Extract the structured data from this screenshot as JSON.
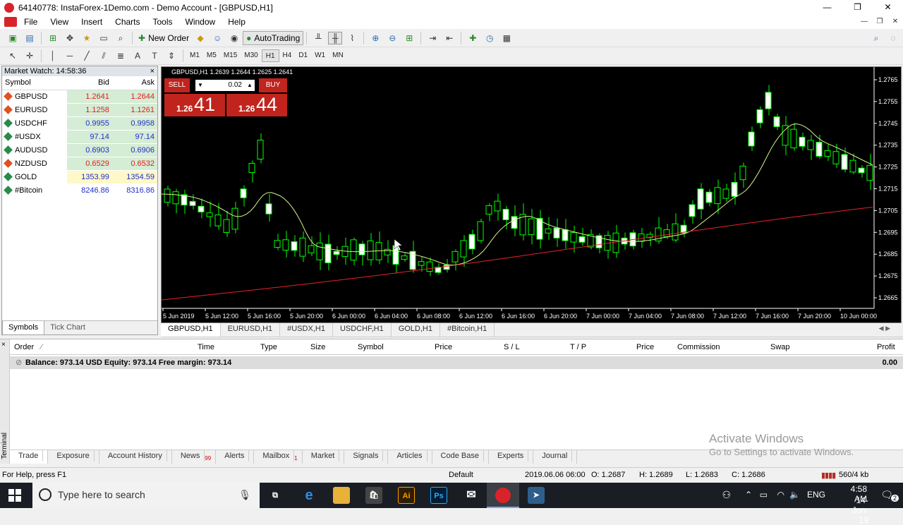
{
  "window": {
    "title": "64140778: InstaForex-1Demo.com - Demo Account - [GBPUSD,H1]",
    "controls": [
      "—",
      "❐",
      "✕"
    ]
  },
  "menu": [
    "File",
    "View",
    "Insert",
    "Charts",
    "Tools",
    "Window",
    "Help"
  ],
  "toolbar": {
    "new_order": "New Order",
    "autotrading": "AutoTrading"
  },
  "timeframes": [
    "M1",
    "M5",
    "M15",
    "M30",
    "H1",
    "H4",
    "D1",
    "W1",
    "MN"
  ],
  "selected_timeframe": "H1",
  "market_watch": {
    "title": "Market Watch: 14:58:36",
    "close": "×",
    "columns": {
      "symbol": "Symbol",
      "bid": "Bid",
      "ask": "Ask"
    },
    "rows": [
      {
        "symbol": "GBPUSD",
        "bid": "1.2641",
        "ask": "1.2644",
        "dir": "down"
      },
      {
        "symbol": "EURUSD",
        "bid": "1.1258",
        "ask": "1.1261",
        "dir": "down"
      },
      {
        "symbol": "USDCHF",
        "bid": "0.9955",
        "ask": "0.9958",
        "dir": "up"
      },
      {
        "symbol": "#USDX",
        "bid": "97.14",
        "ask": "97.14",
        "dir": "up"
      },
      {
        "symbol": "AUDUSD",
        "bid": "0.6903",
        "ask": "0.6906",
        "dir": "up"
      },
      {
        "symbol": "NZDUSD",
        "bid": "0.6529",
        "ask": "0.6532",
        "dir": "down"
      },
      {
        "symbol": "GOLD",
        "bid": "1353.99",
        "ask": "1354.59",
        "dir": "up"
      },
      {
        "symbol": "#Bitcoin",
        "bid": "8246.86",
        "ask": "8316.86",
        "dir": "up"
      }
    ],
    "tabs": [
      "Symbols",
      "Tick Chart"
    ]
  },
  "chart": {
    "header": "GBPUSD,H1  1.2639 1.2644 1.2625 1.2641",
    "one_click": {
      "sell": "SELL",
      "buy": "BUY",
      "lot": "0.02",
      "sell_big": "41",
      "sell_small": "1.26",
      "buy_big": "44",
      "buy_small": "1.26"
    },
    "price_labels": [
      "1.2765",
      "1.2755",
      "1.2745",
      "1.2735",
      "1.2725",
      "1.2715",
      "1.2705",
      "1.2695",
      "1.2685",
      "1.2675",
      "1.2665"
    ],
    "time_labels": [
      "5 Jun 2019",
      "5 Jun 12:00",
      "5 Jun 16:00",
      "5 Jun 20:00",
      "6 Jun 00:00",
      "6 Jun 04:00",
      "6 Jun 08:00",
      "6 Jun 12:00",
      "6 Jun 16:00",
      "6 Jun 20:00",
      "7 Jun 00:00",
      "7 Jun 04:00",
      "7 Jun 08:00",
      "7 Jun 12:00",
      "7 Jun 16:00",
      "7 Jun 20:00",
      "10 Jun 00:00"
    ],
    "colors": {
      "bull": "#ffffff",
      "bear": "#000000",
      "wick": "#00ff00",
      "ma_fast": "#d4f48a",
      "ma_slow": "#e8202a"
    }
  },
  "chart_tabs": [
    "GBPUSD,H1",
    "EURUSD,H1",
    "#USDX,H1",
    "USDCHF,H1",
    "GOLD,H1",
    "#Bitcoin,H1"
  ],
  "terminal": {
    "side_label": "Terminal",
    "columns": [
      "Order",
      "Time",
      "Type",
      "Size",
      "Symbol",
      "Price",
      "S / L",
      "T / P",
      "Price",
      "Commission",
      "Swap",
      "Profit"
    ],
    "balance": "Balance: 973.14 USD  Equity: 973.14  Free margin: 973.14",
    "profit": "0.00",
    "tabs": [
      {
        "label": "Trade",
        "badge": ""
      },
      {
        "label": "Exposure",
        "badge": ""
      },
      {
        "label": "Account History",
        "badge": ""
      },
      {
        "label": "News",
        "badge": "99"
      },
      {
        "label": "Alerts",
        "badge": ""
      },
      {
        "label": "Mailbox",
        "badge": "1"
      },
      {
        "label": "Market",
        "badge": ""
      },
      {
        "label": "Signals",
        "badge": ""
      },
      {
        "label": "Articles",
        "badge": ""
      },
      {
        "label": "Code Base",
        "badge": ""
      },
      {
        "label": "Experts",
        "badge": ""
      },
      {
        "label": "Journal",
        "badge": ""
      }
    ]
  },
  "watermark": {
    "line1": "Activate Windows",
    "line2": "Go to Settings to activate Windows."
  },
  "status": {
    "help": "For Help, press F1",
    "profile": "Default",
    "time": "2019.06.06 06:00",
    "open": "O: 1.2687",
    "high": "H: 1.2689",
    "low": "L: 1.2683",
    "close": "C: 1.2686",
    "traffic": "560/4 kb"
  },
  "taskbar": {
    "search_placeholder": "Type here to search",
    "lang": "ENG",
    "clock": "4:58 AM",
    "date": "14-Jun-19",
    "notif": "2"
  }
}
